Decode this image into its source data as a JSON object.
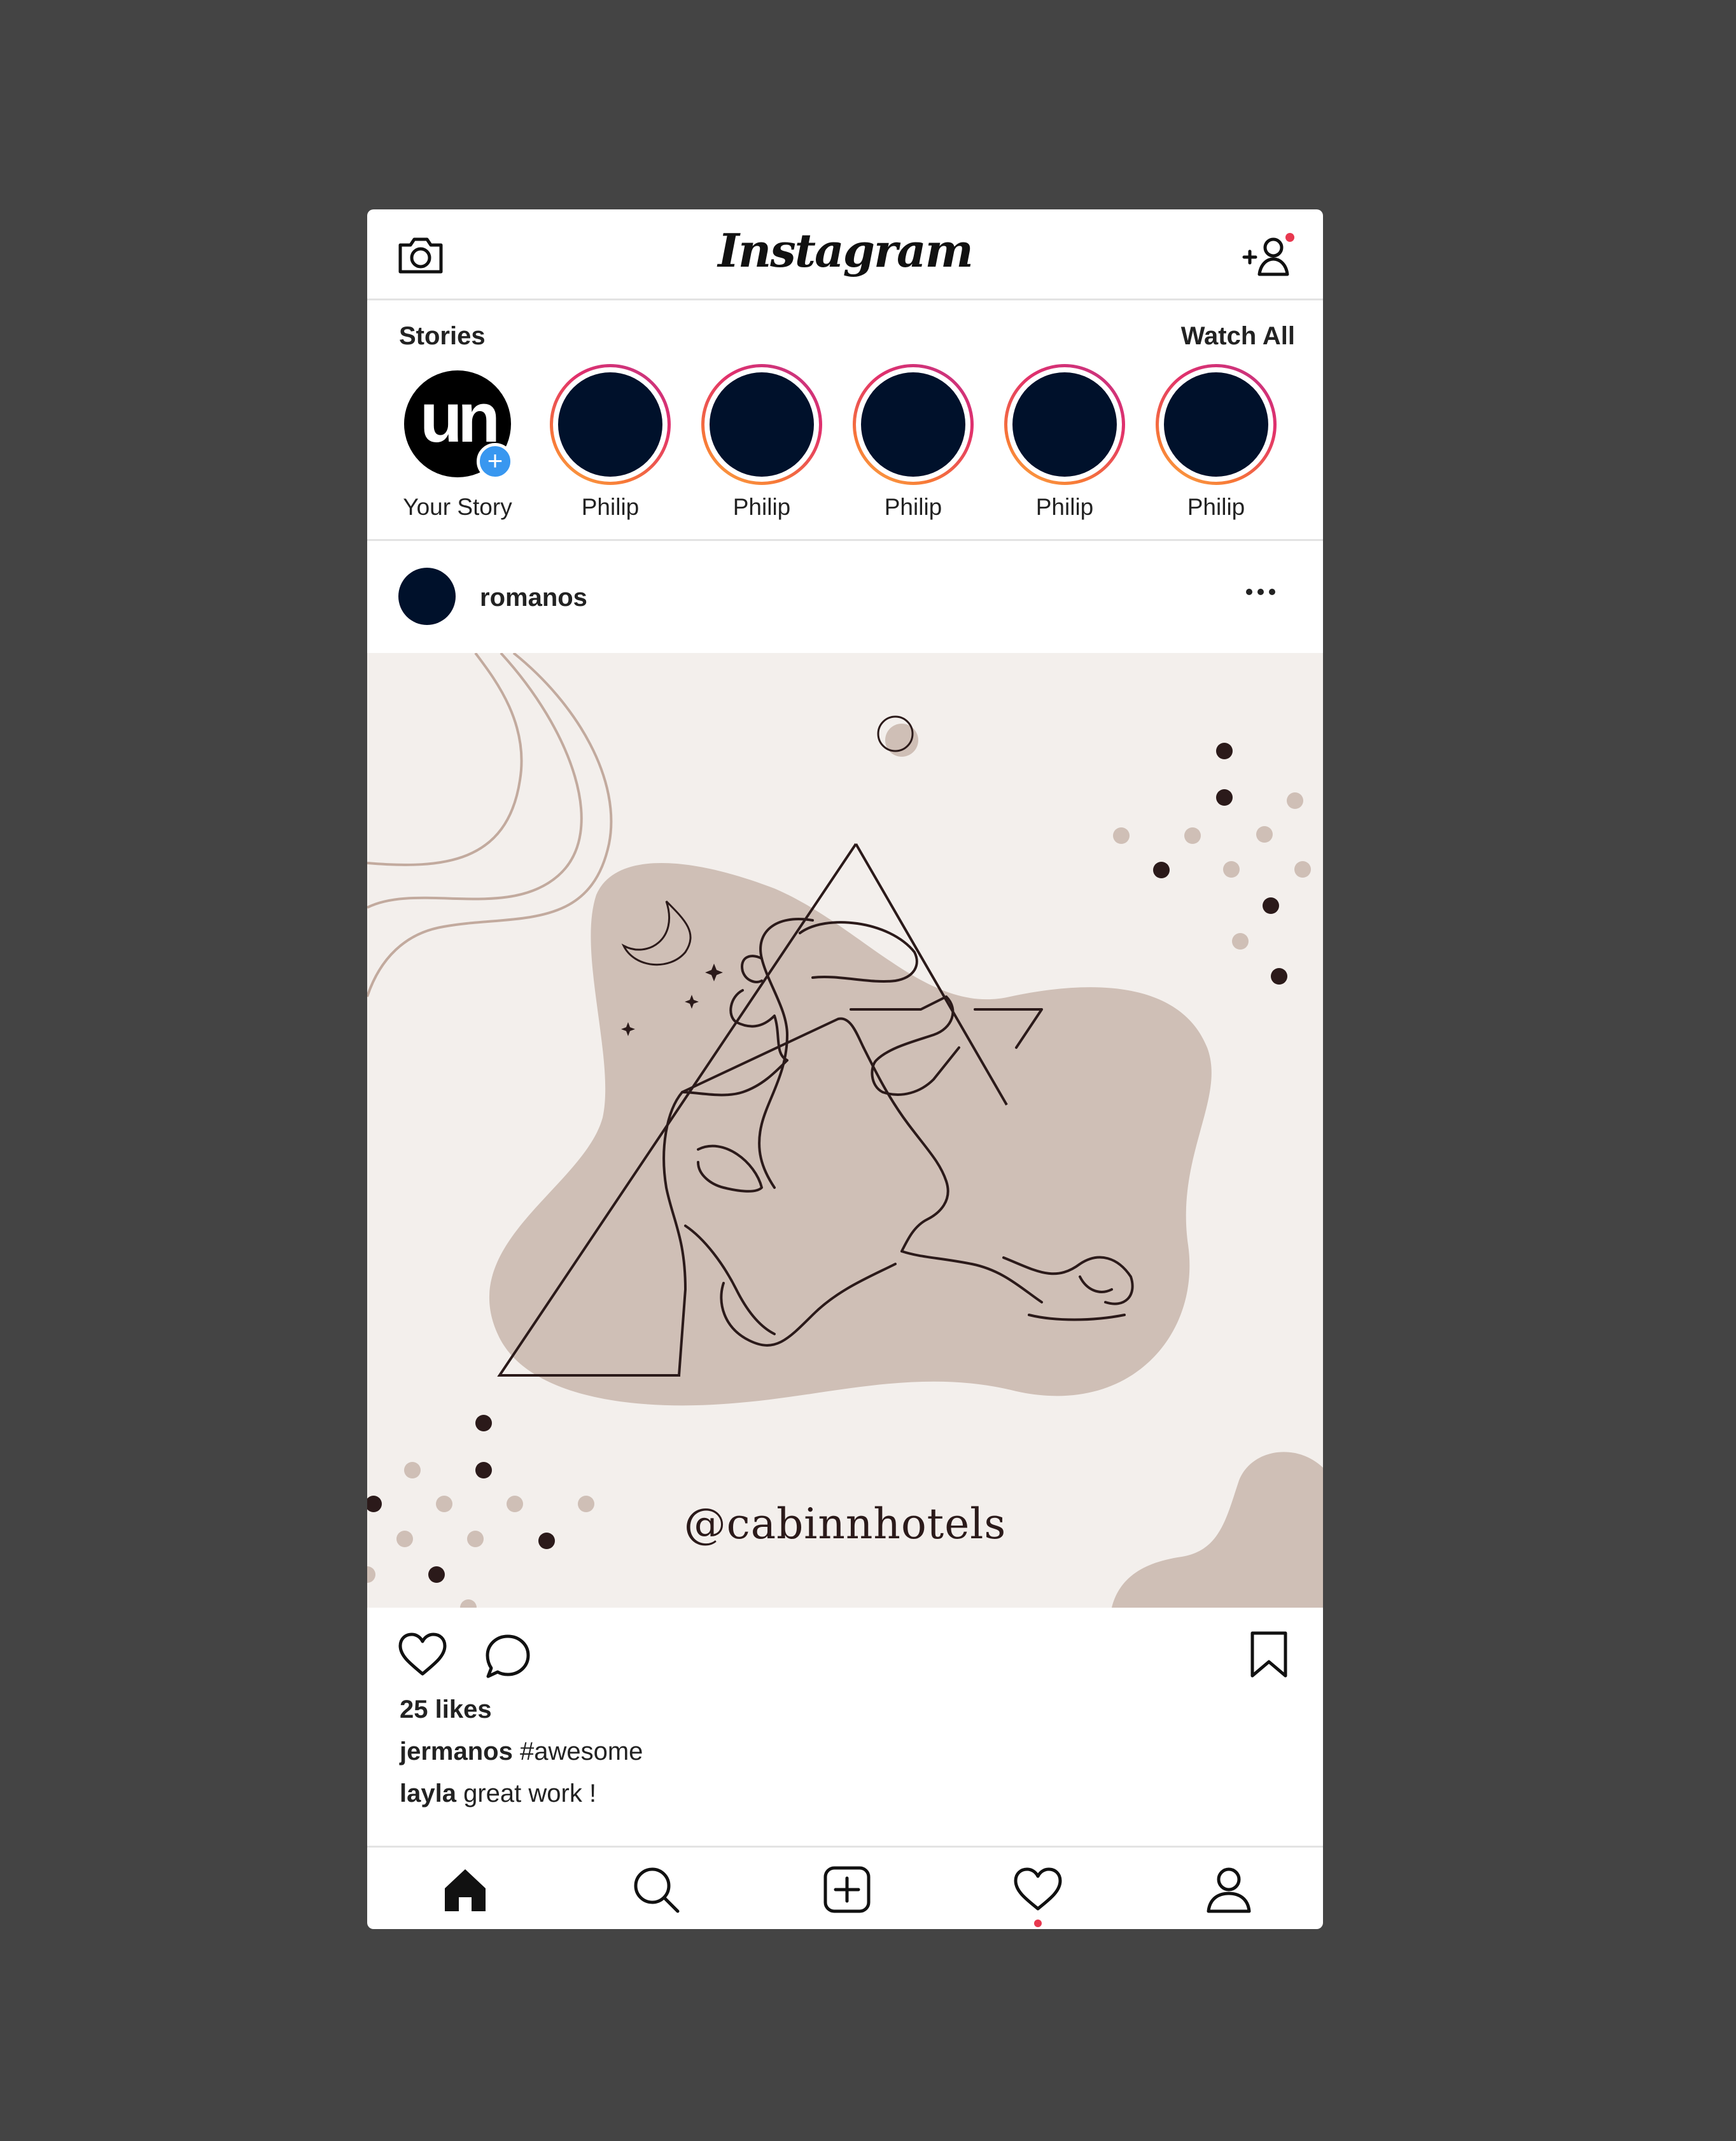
{
  "header": {
    "logo": "Instagram",
    "camera_icon": "camera-icon",
    "add_user_icon": "add-user-icon",
    "notification_color": "#e8384f"
  },
  "stories": {
    "title": "Stories",
    "watch_all": "Watch All",
    "own": {
      "initials": "un",
      "label": "Your Story",
      "plus": "+"
    },
    "items": [
      {
        "label": "Philip"
      },
      {
        "label": "Philip"
      },
      {
        "label": "Philip"
      },
      {
        "label": "Philip"
      },
      {
        "label": "Philip"
      }
    ]
  },
  "post": {
    "username": "romanos",
    "handle": "@cabinnhotels",
    "likes": "25 likes",
    "comments": [
      {
        "user": "jermanos",
        "text": "#awesome"
      },
      {
        "user": "layla",
        "text": "great work !"
      }
    ],
    "palette": {
      "background": "#f3efec",
      "blob": "#cfbfb6",
      "ink": "#2b1a1a",
      "avatar": "#00112b"
    }
  },
  "nav": {
    "items": [
      "home-icon",
      "search-icon",
      "new-post-icon",
      "activity-heart-icon",
      "profile-icon"
    ]
  }
}
